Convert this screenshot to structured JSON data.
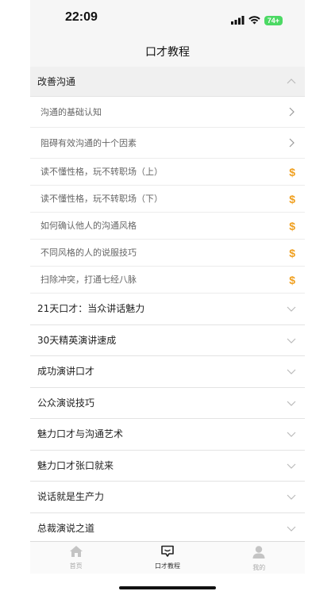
{
  "status": {
    "time": "22:09",
    "battery": "74+"
  },
  "nav": {
    "title": "口才教程"
  },
  "expanded_section": {
    "title": "改善沟通",
    "lessons": [
      {
        "label": "沟通的基础认知",
        "badge": "chevron"
      },
      {
        "label": "阻碍有效沟通的十个因素",
        "badge": "chevron"
      },
      {
        "label": "读不懂性格，玩不转职场（上）",
        "badge": "$"
      },
      {
        "label": "读不懂性格，玩不转职场（下）",
        "badge": "$"
      },
      {
        "label": "如何确认他人的沟通风格",
        "badge": "$"
      },
      {
        "label": "不同风格的人的说服技巧",
        "badge": "$"
      },
      {
        "label": "扫除冲突，打通七经八脉",
        "badge": "$"
      }
    ]
  },
  "categories": [
    "21天口才：当众讲话魅力",
    "30天精英演讲速成",
    "成功演讲口才",
    "公众演说技巧",
    "魅力口才与沟通艺术",
    "魅力口才张口就来",
    "说话就是生产力",
    "总裁演说之道"
  ],
  "tabs": [
    {
      "label": "首页",
      "icon": "home-icon"
    },
    {
      "label": "口才教程",
      "icon": "chat-icon"
    },
    {
      "label": "我的",
      "icon": "person-icon"
    }
  ],
  "colors": {
    "accent": "#f0a020"
  }
}
